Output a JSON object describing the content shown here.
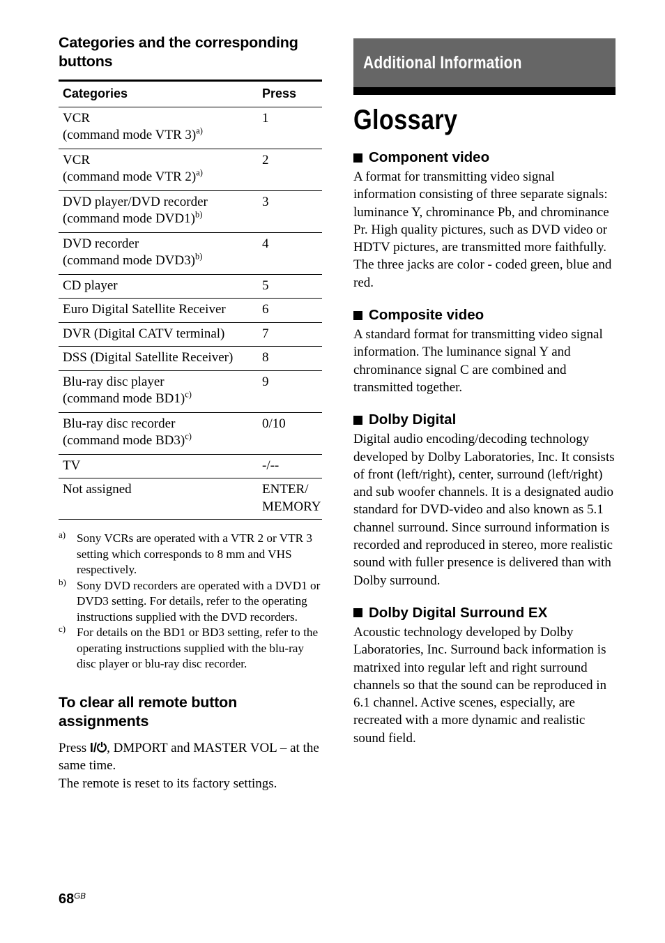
{
  "page": {
    "number": "68",
    "suffix": "GB"
  },
  "left": {
    "heading": "Categories and the corresponding buttons",
    "table": {
      "columns": [
        "Categories",
        "Press"
      ],
      "rows": [
        {
          "category": "VCR (command mode VTR 3)",
          "note": "a)",
          "press": "1"
        },
        {
          "category": "VCR (command mode VTR 2)",
          "note": "a)",
          "press": "2"
        },
        {
          "category": "DVD player/DVD recorder (command mode DVD1)",
          "note": "b)",
          "press": "3"
        },
        {
          "category": "DVD recorder (command mode DVD3)",
          "note": "b)",
          "press": "4"
        },
        {
          "category": "CD player",
          "note": "",
          "press": "5"
        },
        {
          "category": "Euro Digital Satellite Receiver",
          "note": "",
          "press": "6"
        },
        {
          "category": "DVR (Digital CATV terminal)",
          "note": "",
          "press": "7"
        },
        {
          "category": "DSS (Digital Satellite Receiver)",
          "note": "",
          "press": "8"
        },
        {
          "category": "Blu-ray disc player (command mode BD1)",
          "note": "c)",
          "press": "9"
        },
        {
          "category": "Blu-ray disc recorder (command mode BD3)",
          "note": "c)",
          "press": "0/10"
        },
        {
          "category": "TV",
          "note": "",
          "press": "-/--"
        },
        {
          "category": "Not assigned",
          "note": "",
          "press": "ENTER/ MEMORY"
        }
      ]
    },
    "footnotes": [
      {
        "mark": "a)",
        "text": "Sony VCRs are operated with a VTR 2 or VTR 3 setting which corresponds to 8 mm and VHS respectively."
      },
      {
        "mark": "b)",
        "text": "Sony DVD recorders are operated with a DVD1 or DVD3 setting. For details, refer to the operating instructions supplied with the DVD recorders."
      },
      {
        "mark": "c)",
        "text": "For details on the BD1 or BD3 setting, refer to the operating instructions supplied with the blu-ray disc player or blu-ray disc recorder."
      }
    ],
    "clear_section": {
      "heading": "To clear all remote button assignments",
      "line1_prefix": "Press ",
      "line1_key": "I/⏻",
      "line1_suffix": ", DMPORT and MASTER VOL – at the same time.",
      "line2": "The remote is reset to its factory settings."
    }
  },
  "right": {
    "banner": "Additional Information",
    "title": "Glossary",
    "entries": [
      {
        "heading": "Component video",
        "body": "A format for transmitting video signal information consisting of three separate signals: luminance Y, chrominance Pb, and chrominance Pr. High quality pictures, such as DVD video or HDTV pictures, are transmitted more faithfully. The three jacks are color - coded green, blue and red."
      },
      {
        "heading": "Composite video",
        "body": "A standard format for transmitting video signal information. The luminance signal Y and chrominance signal C are combined and transmitted together."
      },
      {
        "heading": "Dolby Digital",
        "body": "Digital audio encoding/decoding technology developed by Dolby Laboratories, Inc. It consists of front (left/right), center, surround (left/right) and sub woofer channels. It is a designated audio standard for DVD-video and also known as 5.1 channel surround. Since surround information is recorded and reproduced in stereo, more realistic sound with fuller presence is delivered than with Dolby surround."
      },
      {
        "heading": "Dolby Digital Surround EX",
        "body": "Acoustic technology developed by Dolby Laboratories, Inc. Surround back information is matrixed into regular left and right surround channels so that the sound can be reproduced in 6.1 channel. Active scenes, especially, are recreated with a more dynamic and realistic sound field."
      }
    ]
  },
  "colors": {
    "banner_bg": "#666666",
    "banner_text": "#ffffff",
    "rule": "#000000"
  }
}
